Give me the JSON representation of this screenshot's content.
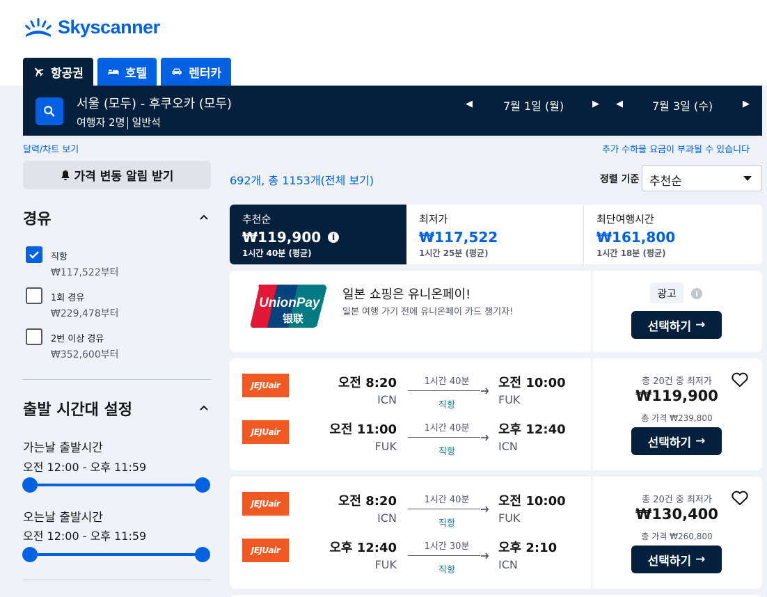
{
  "brand": {
    "name": "Skyscanner",
    "color": "#0062e3"
  },
  "tabs": [
    {
      "label": "항공권",
      "icon": "plane-icon"
    },
    {
      "label": "호텔",
      "icon": "bed-icon"
    },
    {
      "label": "렌터카",
      "icon": "car-icon"
    }
  ],
  "search": {
    "route": "서울 (모두) - 후쿠오카 (모두)",
    "travelers": "여행자 2명",
    "cabin": "일반석",
    "depart_date": "7월 1일 (월)",
    "return_date": "7월 3일 (수)"
  },
  "links": {
    "calendar": "달력/차트 보기",
    "baggage": "추가 수하물 요금이 부과될 수 있습니다"
  },
  "sidebar": {
    "alert_button": "가격 변동 알림 받기",
    "stops_title": "경유",
    "stops": [
      {
        "label": "직항",
        "price": "₩117,522부터",
        "checked": true
      },
      {
        "label": "1회 경유",
        "price": "₩229,478부터",
        "checked": false
      },
      {
        "label": "2번 이상 경유",
        "price": "₩352,600부터",
        "checked": false
      }
    ],
    "time_title": "출발 시간대 설정",
    "outbound_label": "가는날 출발시간",
    "outbound_range": "오전 12:00 - 오후 11:59",
    "return_label": "오는날 출발시간",
    "return_range": "오전 12:00 - 오후 11:59"
  },
  "results": {
    "count": "692개, 총 1153개(전체 보기)",
    "sort_label": "정렬 기준",
    "sort_value": "추천순"
  },
  "sort_tabs": [
    {
      "title": "추천순",
      "price": "₩119,900",
      "duration": "1시간 40분 (평균)",
      "active": true
    },
    {
      "title": "최저가",
      "price": "₩117,522",
      "duration": "1시간 25분 (평균)",
      "active": false
    },
    {
      "title": "최단여행시간",
      "price": "₩161,800",
      "duration": "1시간 18분 (평균)",
      "active": false
    }
  ],
  "ad": {
    "logo_text": "UnionPay",
    "logo_subtext": "银联",
    "title": "일본 쇼핑은 유니온페이!",
    "subtitle": "일본 여행 가기 전에 유니온페이 카드 챙기자!",
    "badge": "광고",
    "button": "선택하기"
  },
  "flights": [
    {
      "airline": "JEJUair",
      "legs": [
        {
          "dep_time": "오전 8:20",
          "dep_ap": "ICN",
          "duration": "1시간 40분",
          "stops": "직항",
          "arr_time": "오전 10:00",
          "arr_ap": "FUK"
        },
        {
          "dep_time": "오전 11:00",
          "dep_ap": "FUK",
          "duration": "1시간 40분",
          "stops": "직항",
          "arr_time": "오후 12:40",
          "arr_ap": "ICN"
        }
      ],
      "cheapest_note": "총 20건 중 최저가",
      "price": "₩119,900",
      "total": "총 가격 ₩239,800",
      "button": "선택하기"
    },
    {
      "airline": "JEJUair",
      "legs": [
        {
          "dep_time": "오전 8:20",
          "dep_ap": "ICN",
          "duration": "1시간 40분",
          "stops": "직항",
          "arr_time": "오전 10:00",
          "arr_ap": "FUK"
        },
        {
          "dep_time": "오후 12:40",
          "dep_ap": "FUK",
          "duration": "1시간 30분",
          "stops": "직항",
          "arr_time": "오후 2:10",
          "arr_ap": "ICN"
        }
      ],
      "cheapest_note": "총 20건 중 최저가",
      "price": "₩130,400",
      "total": "총 가격 ₩260,800",
      "button": "선택하기"
    }
  ]
}
